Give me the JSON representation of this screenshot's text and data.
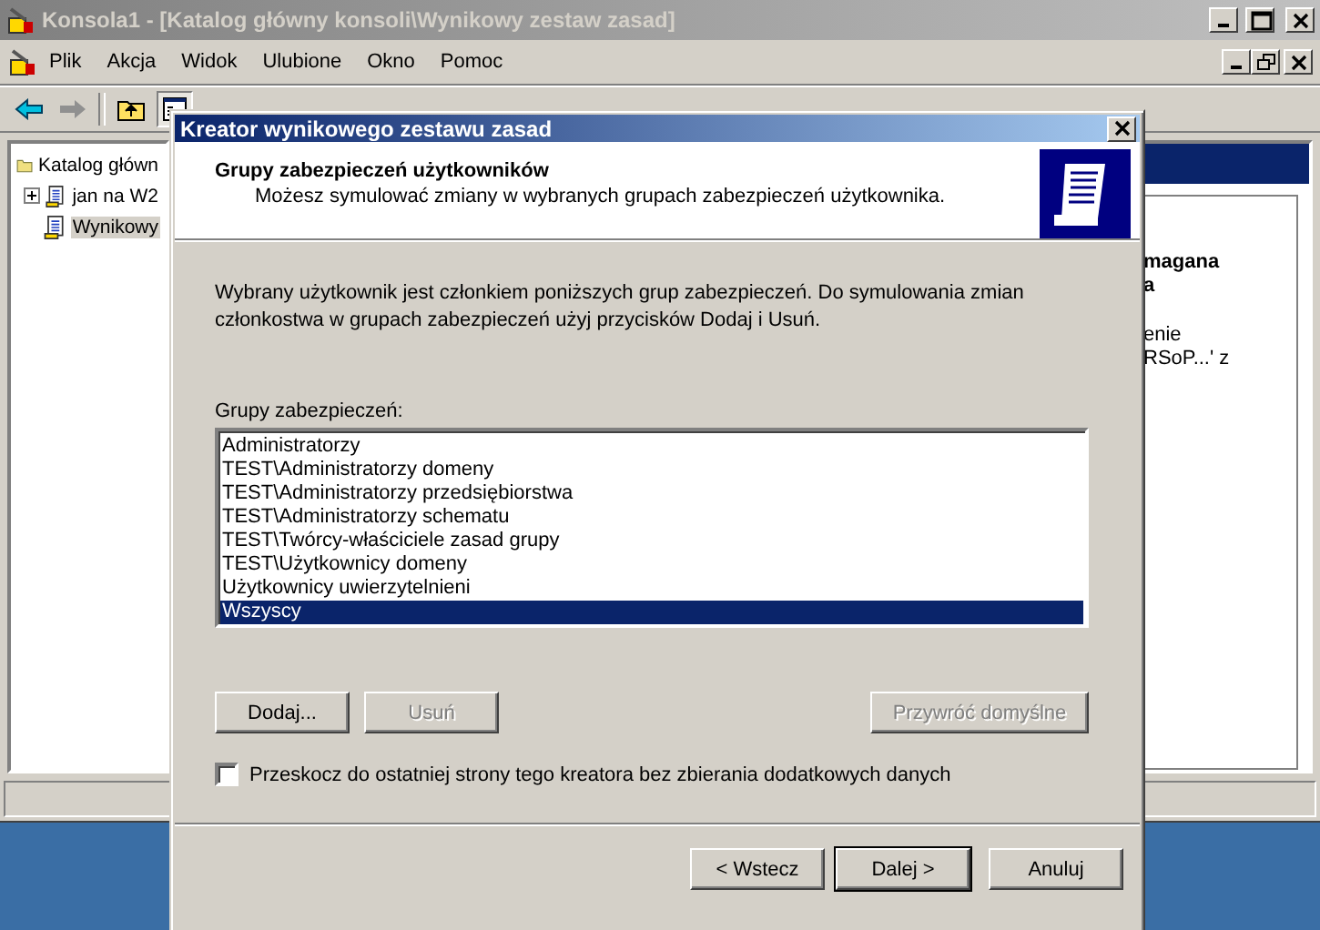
{
  "console": {
    "title": "Konsola1 - [Katalog główny konsoli\\Wynikowy zestaw zasad]",
    "menu": [
      "Plik",
      "Akcja",
      "Widok",
      "Ulubione",
      "Okno",
      "Pomoc"
    ],
    "tree": {
      "label": "Katalog główn",
      "children": [
        {
          "label": "jan na W2",
          "collapsed": true,
          "selected": false
        },
        {
          "label": "Wynikowy",
          "collapsed": false,
          "selected": true
        }
      ]
    },
    "right_pane": [
      {
        "text": "magana",
        "bold": true
      },
      {
        "text": "a",
        "bold": true
      },
      {
        "text": "enie",
        "bold": false
      },
      {
        "text": "RSoP...' z",
        "bold": false
      }
    ]
  },
  "dialog": {
    "title": "Kreator wynikowego zestawu zasad",
    "heading": "Grupy zabezpieczeń użytkowników",
    "subheading": "Możesz symulować zmiany w wybranych grupach zabezpieczeń użytkownika.",
    "description": "Wybrany użytkownik jest członkiem poniższych grup zabezpieczeń. Do symulowania zmian członkostwa w grupach zabezpieczeń użyj przycisków Dodaj i Usuń.",
    "list_label": "Grupy zabezpieczeń:",
    "groups": [
      {
        "label": "Administratorzy",
        "selected": false
      },
      {
        "label": "TEST\\Administratorzy domeny",
        "selected": false
      },
      {
        "label": "TEST\\Administratorzy przedsiębiorstwa",
        "selected": false
      },
      {
        "label": "TEST\\Administratorzy schematu",
        "selected": false
      },
      {
        "label": "TEST\\Twórcy-właściciele zasad grupy",
        "selected": false
      },
      {
        "label": "TEST\\Użytkownicy domeny",
        "selected": false
      },
      {
        "label": "Użytkownicy uwierzytelnieni",
        "selected": false
      },
      {
        "label": "Wszyscy",
        "selected": true
      }
    ],
    "list_buttons": [
      {
        "label": "Dodaj...",
        "disabled": false
      },
      {
        "label": "Usuń",
        "disabled": true
      },
      {
        "label": "Przywróć domyślne",
        "disabled": true
      }
    ],
    "skip_checkbox": {
      "label": "Przeskocz do ostatniej strony tego kreatora bez zbierania dodatkowych danych",
      "checked": false
    },
    "footer_buttons": [
      {
        "label": "< Wstecz",
        "default": false
      },
      {
        "label": "Dalej >",
        "default": true
      },
      {
        "label": "Anuluj",
        "default": false
      }
    ]
  }
}
